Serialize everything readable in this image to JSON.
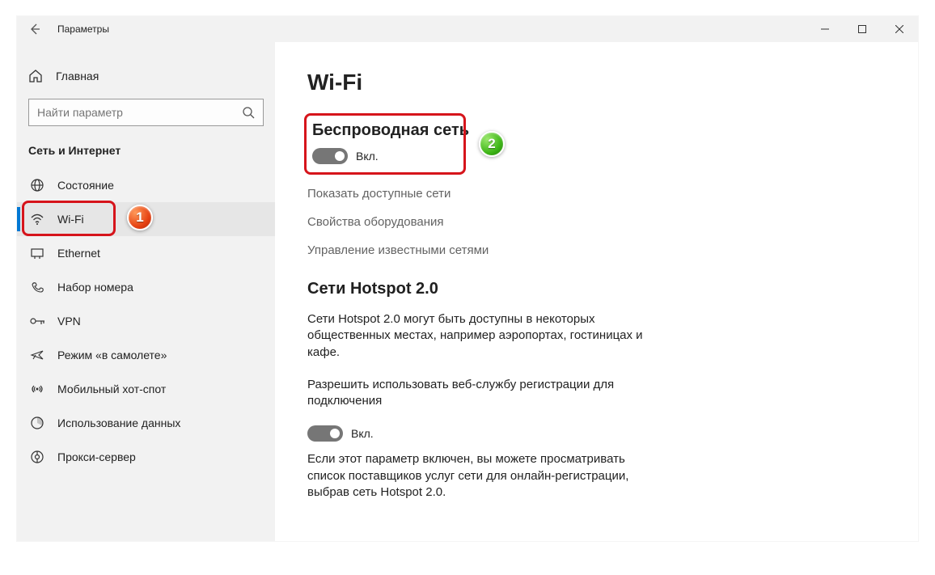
{
  "window": {
    "title": "Параметры"
  },
  "sidebar": {
    "home_label": "Главная",
    "search_placeholder": "Найти параметр",
    "section_header": "Сеть и Интернет",
    "items": [
      {
        "label": "Состояние",
        "icon": "globe-icon"
      },
      {
        "label": "Wi-Fi",
        "icon": "wifi-icon",
        "selected": true
      },
      {
        "label": "Ethernet",
        "icon": "ethernet-icon"
      },
      {
        "label": "Набор номера",
        "icon": "dialup-icon"
      },
      {
        "label": "VPN",
        "icon": "vpn-icon"
      },
      {
        "label": "Режим «в самолете»",
        "icon": "airplane-icon"
      },
      {
        "label": "Мобильный хот-спот",
        "icon": "hotspot-icon"
      },
      {
        "label": "Использование данных",
        "icon": "data-usage-icon"
      },
      {
        "label": "Прокси-сервер",
        "icon": "proxy-icon"
      }
    ]
  },
  "content": {
    "title": "Wi-Fi",
    "wireless": {
      "heading": "Беспроводная сеть",
      "toggle_label": "Вкл."
    },
    "links": {
      "available": "Показать доступные сети",
      "hardware": "Свойства оборудования",
      "known": "Управление известными сетями"
    },
    "hotspot": {
      "heading": "Сети Hotspot 2.0",
      "desc1": "Сети Hotspot 2.0 могут быть доступны в некоторых общественных местах, например аэропортах, гостиницах и кафе.",
      "permit": "Разрешить использовать веб-службу регистрации для подключения",
      "toggle_label": "Вкл.",
      "desc2": "Если этот параметр включен, вы можете просматривать список поставщиков услуг сети для онлайн-регистрации, выбрав сеть Hotspot 2.0."
    }
  },
  "badges": {
    "one": "1",
    "two": "2"
  }
}
